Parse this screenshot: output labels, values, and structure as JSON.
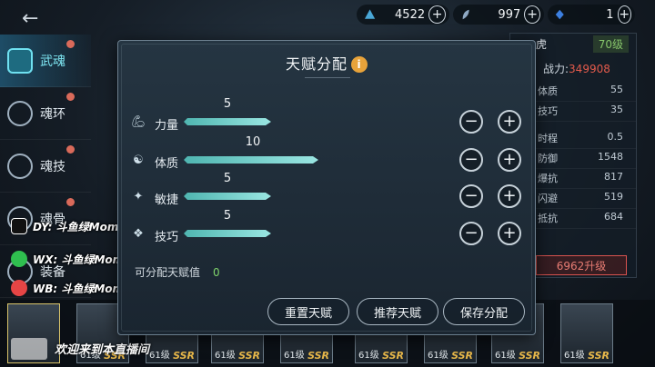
{
  "resources": [
    {
      "icon": "wing-icon",
      "value": "4522"
    },
    {
      "icon": "feather-icon",
      "value": "997"
    },
    {
      "icon": "crystal-icon",
      "value": "1"
    }
  ],
  "left_nav": [
    {
      "label": "武魂",
      "active": true
    },
    {
      "label": "魂环",
      "active": false
    },
    {
      "label": "魂技",
      "active": false
    },
    {
      "label": "魂骨",
      "active": false
    },
    {
      "label": "装备",
      "active": false
    }
  ],
  "right_panel": {
    "name_suffix": "虎",
    "level": "70级",
    "power_label": "战力:",
    "power_value": "349908",
    "stats": [
      {
        "label": "体质",
        "value": "55"
      },
      {
        "label": "技巧",
        "value": "35"
      },
      {
        "label": "时程",
        "value": "0.5"
      },
      {
        "label": "防御",
        "value": "1548"
      },
      {
        "label": "爆抗",
        "value": "817"
      },
      {
        "label": "闪避",
        "value": "519"
      },
      {
        "label": "抵抗",
        "value": "684"
      }
    ],
    "upgrade_label": "6962升级"
  },
  "cards": [
    {
      "level": "",
      "ssr": ""
    },
    {
      "level": "61级",
      "ssr": "SSR"
    },
    {
      "level": "61级",
      "ssr": "SSR"
    },
    {
      "level": "61级",
      "ssr": "SSR"
    },
    {
      "level": "61级",
      "ssr": "SSR"
    },
    {
      "level": "61级",
      "ssr": "SSR"
    },
    {
      "level": "61级",
      "ssr": "SSR"
    },
    {
      "level": "61级",
      "ssr": "SSR"
    },
    {
      "level": "61级",
      "ssr": "SSR"
    }
  ],
  "overlay": {
    "douyin": "DY: 斗鱼绿Momo",
    "wechat": "WX: 斗鱼绿Momo",
    "weibo": "WB: 斗鱼绿Momo",
    "welcome": "欢迎来到本直播间"
  },
  "modal": {
    "title": "天赋分配",
    "stats": [
      {
        "icon": "arm-icon",
        "label": "力量",
        "value": 5
      },
      {
        "icon": "body-icon",
        "label": "体质",
        "value": 10
      },
      {
        "icon": "agility-icon",
        "label": "敏捷",
        "value": 5
      },
      {
        "icon": "skill-icon",
        "label": "技巧",
        "value": 5
      }
    ],
    "remaining_label": "可分配天赋值",
    "remaining_value": "0",
    "reset_label": "重置天赋",
    "recommend_label": "推荐天赋",
    "save_label": "保存分配",
    "minus": "−",
    "plus": "+"
  },
  "colors": {
    "bar": "#7fd6d2",
    "accent": "#e8a33a",
    "remaining": "#7fd46b",
    "power": "#e35a4b"
  }
}
